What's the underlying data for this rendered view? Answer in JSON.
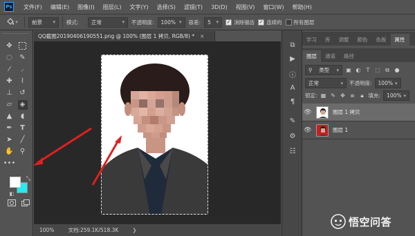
{
  "app": {
    "logo": "Ps"
  },
  "menu": [
    "文件(F)",
    "编辑(E)",
    "图像(I)",
    "图层(L)",
    "文字(Y)",
    "选择(S)",
    "滤镜(T)",
    "3D(D)",
    "视图(V)",
    "窗口(W)",
    "帮助(H)"
  ],
  "options": {
    "tool_icon": "paint-bucket-icon",
    "fill_source": "前景",
    "mode_label": "模式:",
    "mode_value": "正常",
    "opacity_label": "不透明度:",
    "opacity_value": "100%",
    "tolerance_label": "容差:",
    "tolerance_value": "5",
    "antialias_label": "消除锯齿",
    "contiguous_label": "连续的",
    "all_layers_label": "所有图层"
  },
  "document": {
    "tab_title": "QQ截图20190406190551.png @ 100% (图层 1 拷贝, RGB/8) *",
    "tab_close": "×",
    "zoom": "100%",
    "doc_size": "文档:259.1K/518.3K"
  },
  "colors": {
    "foreground": "#ffffff",
    "background": "#27e9f0",
    "arrow": "#e01f1f"
  },
  "panels": {
    "top_tabs": [
      "学习",
      "库",
      "调整",
      "颜色",
      "色板",
      "属性"
    ],
    "layer_tabs": [
      "图层",
      "通道",
      "路径"
    ],
    "filter_kind": "类型",
    "blend_mode": "正常",
    "opacity_label": "不透明度:",
    "opacity_value": "100%",
    "lock_label": "锁定:",
    "fill_label": "填充:",
    "fill_value": "100%",
    "layers": [
      {
        "name": "图层 1 拷贝",
        "selected": true
      },
      {
        "name": "图层 1",
        "selected": false
      }
    ]
  },
  "watermark": "悟空问答"
}
